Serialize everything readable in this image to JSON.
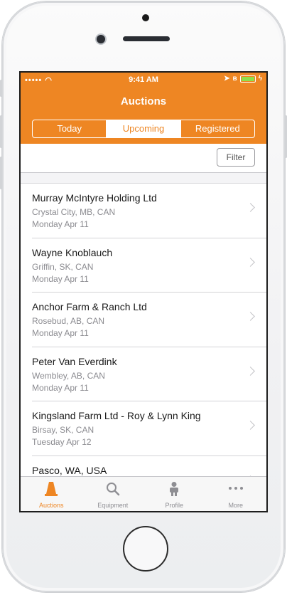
{
  "status_bar": {
    "signal": "•••••",
    "time": "9:41 AM"
  },
  "nav": {
    "title": "Auctions"
  },
  "segments": [
    {
      "label": "Today",
      "active": false
    },
    {
      "label": "Upcoming",
      "active": true
    },
    {
      "label": "Registered",
      "active": false
    }
  ],
  "filter": {
    "label": "Filter"
  },
  "auctions": [
    {
      "name": "Murray McIntyre Holding Ltd",
      "location": "Crystal City, MB, CAN",
      "date": "Monday Apr 11"
    },
    {
      "name": "Wayne Knoblauch",
      "location": "Griffin, SK, CAN",
      "date": "Monday Apr 11"
    },
    {
      "name": "Anchor Farm & Ranch Ltd",
      "location": "Rosebud, AB, CAN",
      "date": "Monday Apr 11"
    },
    {
      "name": "Peter Van Everdink",
      "location": "Wembley, AB, CAN",
      "date": "Monday Apr 11"
    },
    {
      "name": "Kingsland Farm Ltd - Roy & Lynn King",
      "location": "Birsay, SK, CAN",
      "date": "Tuesday Apr 12"
    },
    {
      "name": "Pasco, WA, USA",
      "location": "",
      "date": ""
    }
  ],
  "tabs": [
    {
      "label": "Auctions",
      "icon": "cone-icon",
      "active": true
    },
    {
      "label": "Equipment",
      "icon": "search-icon",
      "active": false
    },
    {
      "label": "Profile",
      "icon": "person-icon",
      "active": false
    },
    {
      "label": "More",
      "icon": "more-icon",
      "active": false
    }
  ],
  "colors": {
    "accent": "#ee8623",
    "inactive": "#8e8e93"
  }
}
